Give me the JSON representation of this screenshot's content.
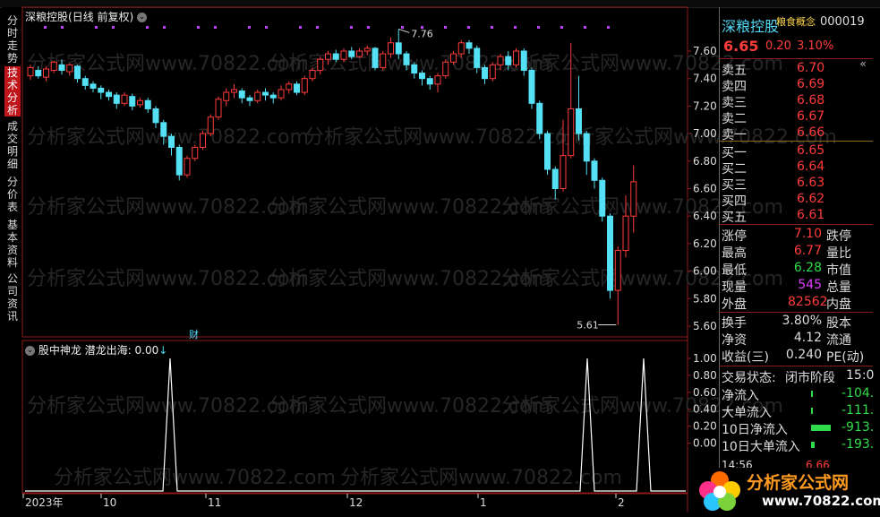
{
  "title": {
    "stock_name": "深粮控股",
    "period": "(日线 前复权)"
  },
  "nav_tabs": [
    "分时走势",
    "技术分析",
    "成交明细",
    "分价表",
    "基本资料",
    "公司资讯"
  ],
  "price_axis": [
    "7.60",
    "7.40",
    "7.20",
    "7.00",
    "6.80",
    "6.60",
    "6.40",
    "6.20",
    "6.00",
    "5.80",
    "5.60"
  ],
  "indicator": {
    "name": "股中神龙",
    "series_label": "潜龙出海: 0.00",
    "axis": [
      "1.00",
      "0.80",
      "0.60",
      "0.40",
      "0.20",
      "0.00"
    ]
  },
  "date_axis": [
    "2023年",
    "10",
    "11",
    "12",
    "1",
    "2"
  ],
  "annotations": {
    "high": "7.76",
    "low": "5.61",
    "finance_marker": "财"
  },
  "watermark": "分析家公式网www.70822.com",
  "right": {
    "name": "深粮控股",
    "concept": "粮食概念",
    "code": "000019",
    "price": "6.65",
    "change": "0.20",
    "pct": "3.10%",
    "sell": [
      {
        "label": "卖五",
        "price": "6.70"
      },
      {
        "label": "卖四",
        "price": "6.69"
      },
      {
        "label": "卖三",
        "price": "6.68"
      },
      {
        "label": "卖二",
        "price": "6.67"
      },
      {
        "label": "卖一",
        "price": "6.66"
      }
    ],
    "buy": [
      {
        "label": "买一",
        "price": "6.65"
      },
      {
        "label": "买二",
        "price": "6.64"
      },
      {
        "label": "买三",
        "price": "6.63"
      },
      {
        "label": "买四",
        "price": "6.62"
      },
      {
        "label": "买五",
        "price": "6.61"
      }
    ],
    "stats": [
      {
        "l": "涨停",
        "v": "7.10",
        "r": "跌停",
        "c": "red"
      },
      {
        "l": "最高",
        "v": "6.77",
        "r": "量比",
        "c": "red"
      },
      {
        "l": "最低",
        "v": "6.28",
        "r": "市值",
        "c": "grn"
      },
      {
        "l": "现量",
        "v": "545",
        "r": "总量",
        "c": "mag"
      },
      {
        "l": "外盘",
        "v": "82562",
        "r": "内盘",
        "c": "red"
      }
    ],
    "stats2": [
      {
        "l": "换手",
        "v": "3.80%",
        "r": "股本"
      },
      {
        "l": "净资",
        "v": "4.12",
        "r": "流通"
      },
      {
        "l": "收益(三)",
        "v": "0.240",
        "r": "PE(动)"
      }
    ],
    "trade_state_label": "交易状态:",
    "trade_state": "闭市阶段",
    "trade_time": "15:0",
    "flows": [
      {
        "l": "净流入",
        "v": "-104."
      },
      {
        "l": "大单流入",
        "v": "-111."
      },
      {
        "l": "10日净流入",
        "v": "-913."
      },
      {
        "l": "10日大单流入",
        "v": "-193."
      }
    ],
    "last_tick_time": "14:56",
    "last_tick_price": "6.66"
  },
  "logo": {
    "text": "分析家公式网",
    "url": "www.70822.com"
  }
}
